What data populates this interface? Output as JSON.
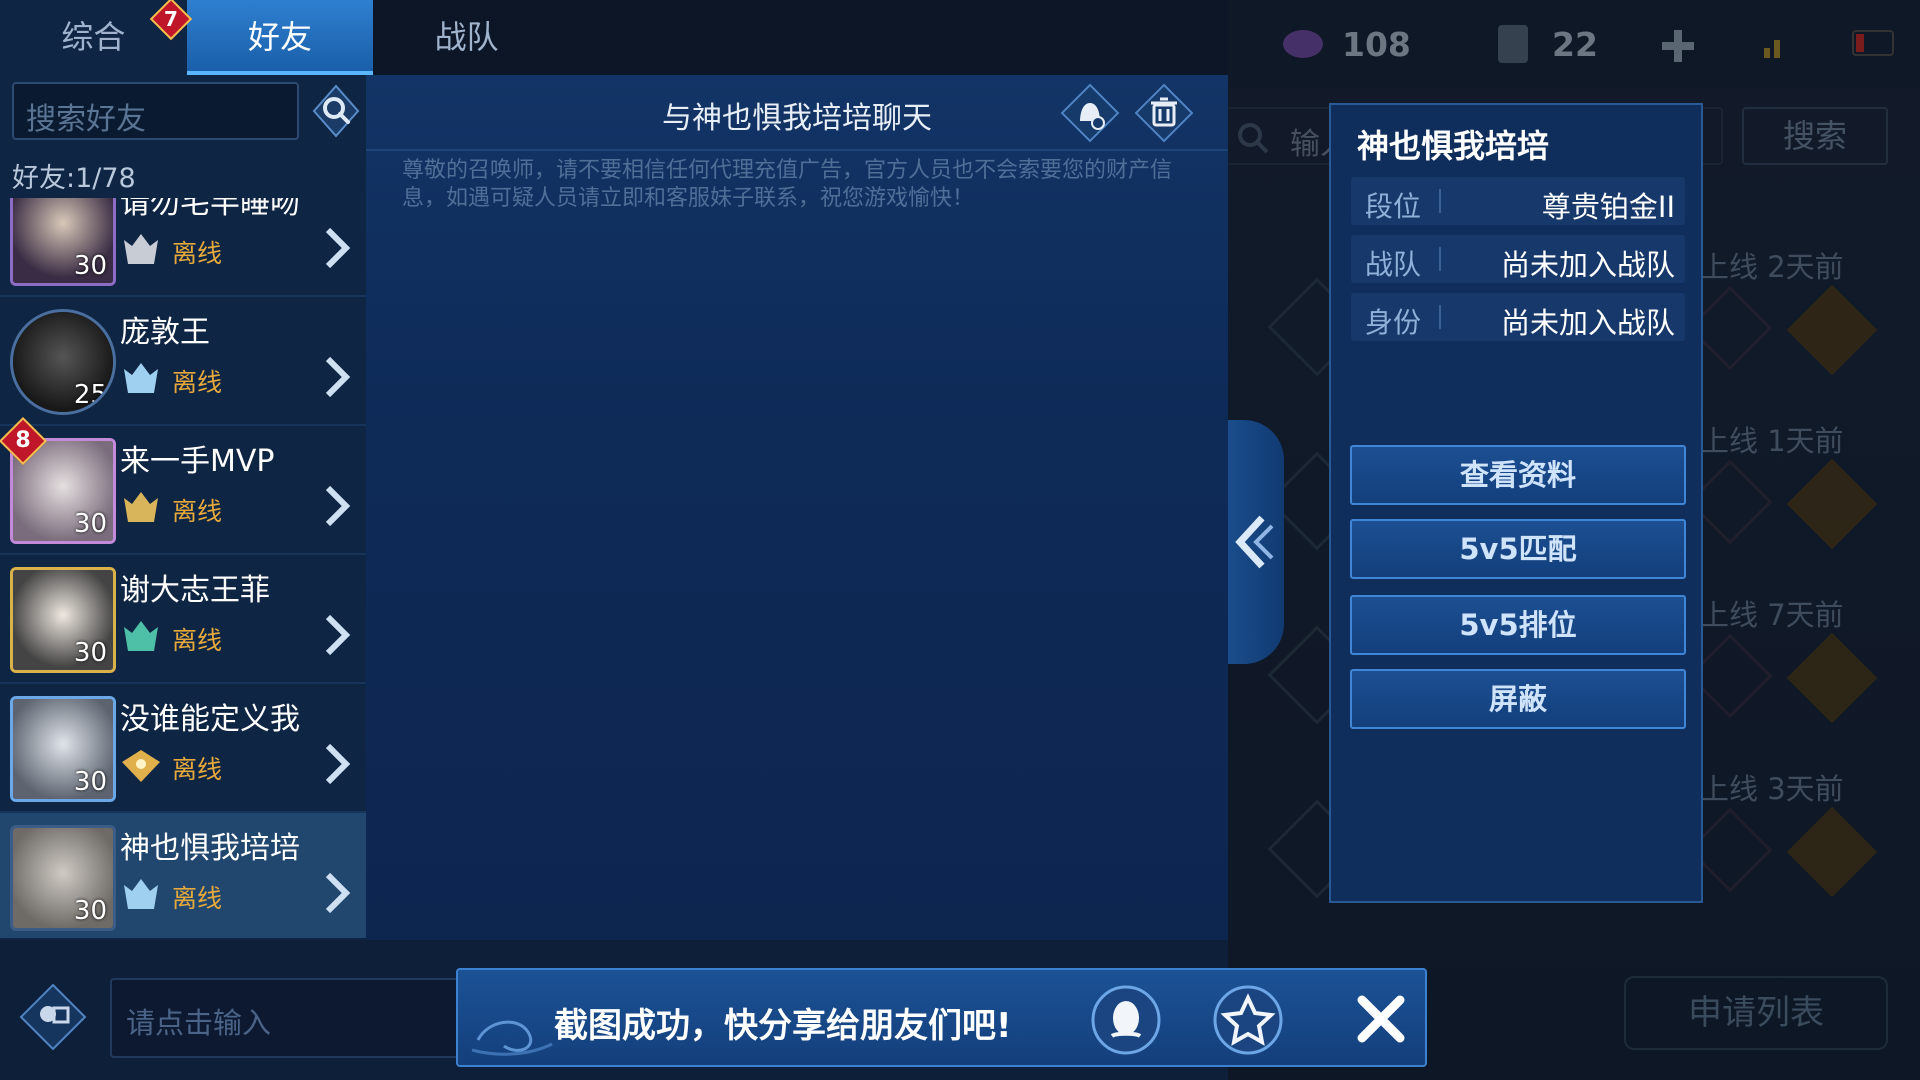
{
  "tabs": [
    {
      "label": "综合"
    },
    {
      "label": "好友"
    },
    {
      "label": "战队"
    }
  ],
  "tab_badge": "7",
  "search": {
    "placeholder": "搜索好友"
  },
  "friend_count": "好友:1/78",
  "friends": [
    {
      "name": "请勿宅半睡吻",
      "level": "30",
      "status": "离线"
    },
    {
      "name": "庞敦王",
      "level": "25",
      "status": "离线"
    },
    {
      "name": "来一手MVP",
      "level": "30",
      "status": "离线"
    },
    {
      "name": "谢大志王菲",
      "level": "30",
      "status": "离线"
    },
    {
      "name": "没谁能定义我",
      "level": "30",
      "status": "离线"
    },
    {
      "name": "神也惧我培培",
      "level": "30",
      "status": "离线"
    }
  ],
  "avatar_badge": "8",
  "chat": {
    "title": "与神也惧我培培聊天",
    "notice": "尊敬的召唤师，请不要相信任何代理充值广告，官方人员也不会索要您的财产信息，如遇可疑人员请立即和客服妹子联系，祝您游戏愉快！",
    "input_placeholder": "请点击输入"
  },
  "resources": {
    "gems": "108",
    "cards": "22"
  },
  "background": {
    "search_placeholder": "输入",
    "search_button": "搜索",
    "rows": [
      {
        "last_online": "上线  2天前"
      },
      {
        "last_online": "上线  1天前"
      },
      {
        "last_online": "上线  7天前"
      },
      {
        "last_online": "上线  3天前"
      }
    ],
    "apply_list": "申请列表"
  },
  "profile": {
    "name": "神也惧我培培",
    "rows": [
      {
        "key": "段位",
        "value": "尊贵铂金II"
      },
      {
        "key": "战队",
        "value": "尚未加入战队"
      },
      {
        "key": "身份",
        "value": "尚未加入战队"
      }
    ],
    "buttons": [
      {
        "label": "查看资料"
      },
      {
        "label": "5v5匹配"
      },
      {
        "label": "5v5排位"
      },
      {
        "label": "屏蔽"
      }
    ]
  },
  "toast": {
    "text": "截图成功，快分享给朋友们吧!"
  }
}
